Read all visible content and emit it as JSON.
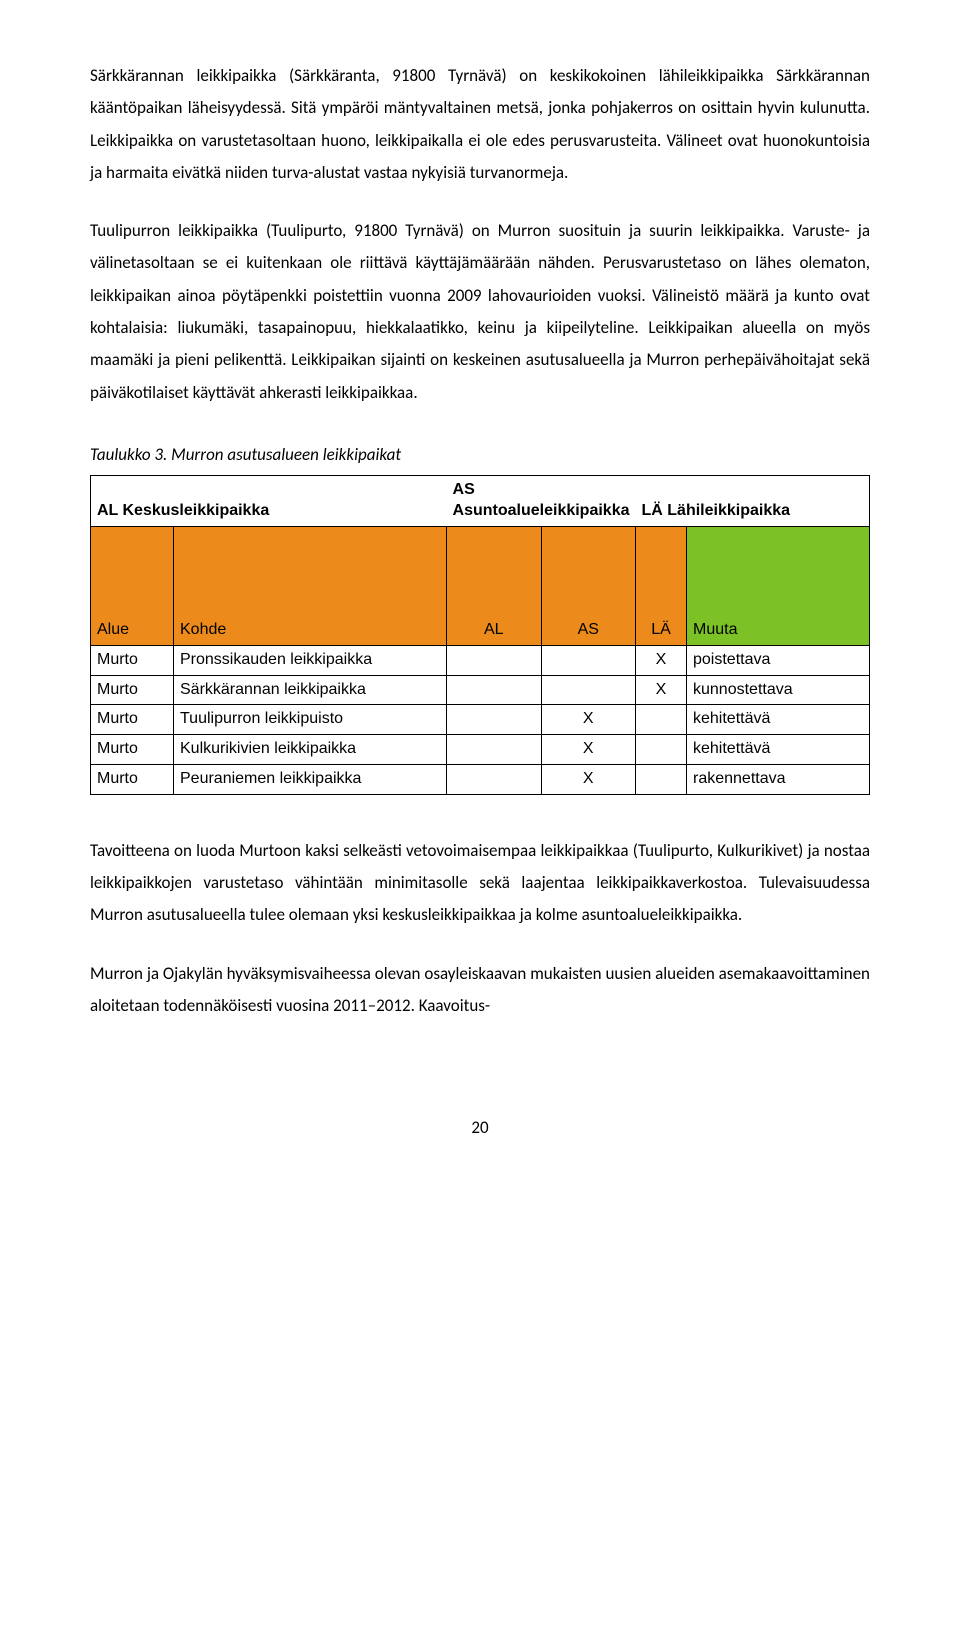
{
  "paragraphs": {
    "p1": "Särkkärannan leikkipaikka (Särkkäranta, 91800 Tyrnävä) on keskikokoinen lähileikkipaikka Särkkärannan kääntöpaikan läheisyydessä. Sitä ympäröi mäntyvaltainen metsä, jonka pohjakerros on osittain hyvin kulunutta. Leikkipaikka on varustetasoltaan huono, leikkipaikalla ei ole edes perusvarusteita. Välineet ovat huonokuntoisia ja harmaita eivätkä niiden turva-alustat vastaa nykyisiä turvanormeja.",
    "p2": "Tuulipurron leikkipaikka (Tuulipurto, 91800 Tyrnävä) on Murron suosituin ja suurin leikkipaikka. Varuste- ja välinetasoltaan se ei kuitenkaan ole riittävä käyttäjämäärään nähden. Perusvarustetaso on lähes olematon, leikkipaikan ainoa pöytäpenkki poistettiin vuonna 2009 lahovaurioiden vuoksi. Välineistö määrä ja kunto ovat kohtalaisia: liukumäki, tasapainopuu, hiekkalaatikko, keinu ja kiipeilyteline. Leikkipaikan alueella on myös maamäki ja pieni pelikenttä. Leikkipaikan sijainti on keskeinen asutusalueella ja Murron perhepäivähoitajat sekä päiväkotilaiset käyttävät ahkerasti leikkipaikkaa.",
    "p3": "Tavoitteena on luoda Murtoon kaksi selkeästi vetovoimaisempaa leikkipaikkaa (Tuulipurto, Kulkurikivet) ja nostaa leikkipaikkojen varustetaso vähintään minimitasolle sekä laajentaa leikkipaikkaverkostoa. Tulevaisuudessa Murron asutusalueella tulee olemaan yksi keskusleikkipaikkaa ja kolme asuntoalueleikkipaikka.",
    "p4": "Murron ja Ojakylän hyväksymisvaiheessa olevan osayleiskaavan mukaisten uusien alueiden asemakaavoittaminen aloitetaan todennäköisesti vuosina 2011–2012. Kaavoitus-"
  },
  "table": {
    "caption": "Taulukko 3. Murron asutusalueen leikkipaikat",
    "legend": {
      "al": "AL Keskusleikkipaikka",
      "as": "AS Asuntoalueleikkipaikka",
      "la": "LÄ Lähileikkipaikka"
    },
    "headers": {
      "area": "Alue",
      "kohde": "Kohde",
      "al": "AL",
      "as": "AS",
      "la": "LÄ",
      "muuta": "Muuta"
    },
    "rows": [
      {
        "area": "Murto",
        "kohde": "Pronssikauden leikkipaikka",
        "al": "",
        "as": "",
        "la": "X",
        "muuta": "poistettava"
      },
      {
        "area": "Murto",
        "kohde": "Särkkärannan leikkipaikka",
        "al": "",
        "as": "",
        "la": "X",
        "muuta": "kunnostettava"
      },
      {
        "area": "Murto",
        "kohde": "Tuulipurron leikkipuisto",
        "al": "",
        "as": "X",
        "la": "",
        "muuta": "kehitettävä"
      },
      {
        "area": "Murto",
        "kohde": "Kulkurikivien leikkipaikka",
        "al": "",
        "as": "X",
        "la": "",
        "muuta": "kehitettävä"
      },
      {
        "area": "Murto",
        "kohde": "Peuraniemen leikkipaikka",
        "al": "",
        "as": "X",
        "la": "",
        "muuta": "rakennettava"
      }
    ]
  },
  "page_number": "20"
}
